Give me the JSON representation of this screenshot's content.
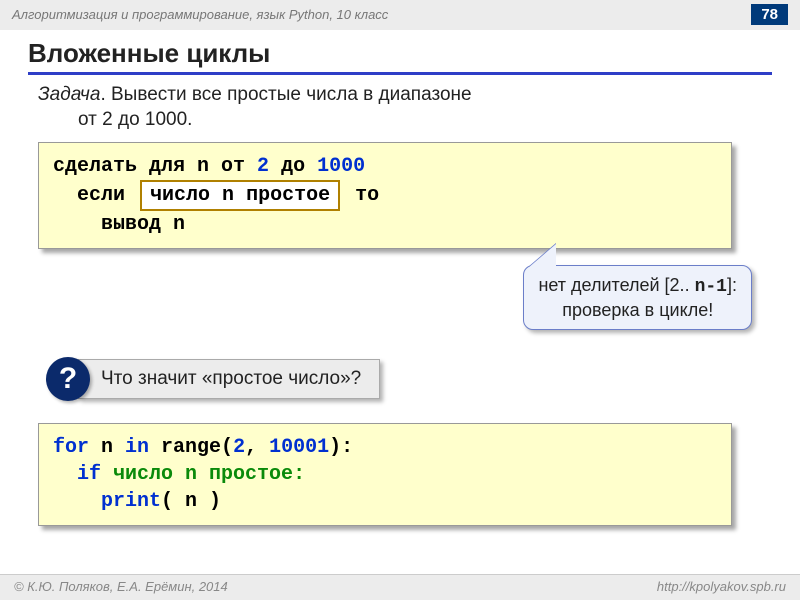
{
  "header": {
    "title": "Алгоритмизация и программирование, язык Python, 10 класс",
    "page": "78"
  },
  "heading": "Вложенные циклы",
  "task": {
    "label": "Задача",
    "line1": ". Вывести все простые числа в диапазоне",
    "line2": "от 2 до 1000."
  },
  "pseudo": {
    "l1a": "сделать для n от ",
    "l1n1": "2",
    "l1b": " до ",
    "l1n2": "1000",
    "l2a": "если",
    "l2box": "число n простое",
    "l2b": "то",
    "l3": "вывод n"
  },
  "callout": {
    "l1a": "нет делителей [2.. ",
    "l1b": "n-1",
    "l1c": "]:",
    "l2": "проверка в цикле!"
  },
  "question": {
    "mark": "?",
    "text": "Что значит «простое число»?"
  },
  "code": {
    "l1a": "for",
    "l1b": " n ",
    "l1c": "in",
    "l1d": " range(",
    "l1e": "2",
    "l1f": ", ",
    "l1g": "10001",
    "l1h": "):",
    "l2a": "if",
    "l2b": " число n простое:",
    "l3a": "print",
    "l3b": "( n )"
  },
  "footer": {
    "left": "© К.Ю. Поляков, Е.А. Ерёмин, 2014",
    "right": "http://kpolyakov.spb.ru"
  }
}
